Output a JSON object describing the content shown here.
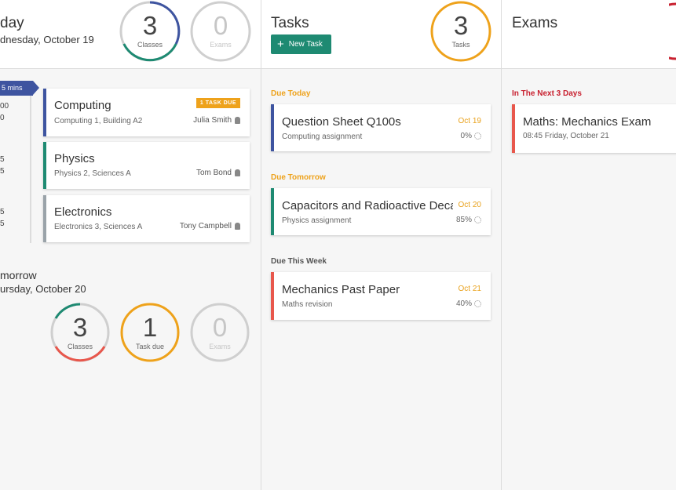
{
  "today": {
    "title": "day",
    "date": "dnesday, October 19",
    "rings": [
      {
        "value": "3",
        "label": "Classes"
      },
      {
        "value": "0",
        "label": "Exams"
      }
    ],
    "countdown": "5 mins",
    "times": [
      "00",
      "0",
      "5",
      "5",
      "5",
      "5"
    ],
    "classes": [
      {
        "name": "Computing",
        "location": "Computing 1, Building A2",
        "teacher": "Julia Smith",
        "badge": "1 TASK DUE",
        "color": "#3e54a0"
      },
      {
        "name": "Physics",
        "location": "Physics 2, Sciences A",
        "teacher": "Tom Bond",
        "color": "#1e8a72"
      },
      {
        "name": "Electronics",
        "location": "Electronics 3, Sciences A",
        "teacher": "Tony Campbell",
        "color": "#9aa3a9"
      }
    ]
  },
  "tomorrow": {
    "title": "morrow",
    "date": "ursday, October 20",
    "rings": [
      {
        "value": "3",
        "label": "Classes"
      },
      {
        "value": "1",
        "label": "Task due"
      },
      {
        "value": "0",
        "label": "Exams"
      }
    ]
  },
  "tasks": {
    "title": "Tasks",
    "new_task_label": "New Task",
    "ring": {
      "value": "3",
      "label": "Tasks"
    },
    "sections": [
      {
        "label": "Due Today",
        "items": [
          {
            "title": "Question Sheet Q100s",
            "subject": "Computing assignment",
            "date": "Oct 19",
            "progress": "0%"
          }
        ]
      },
      {
        "label": "Due Tomorrow",
        "items": [
          {
            "title": "Capacitors and Radioactive Decay",
            "subject": "Physics assignment",
            "date": "Oct 20",
            "progress": "85%"
          }
        ]
      },
      {
        "label": "Due This Week",
        "items": [
          {
            "title": "Mechanics Past Paper",
            "subject": "Maths revision",
            "date": "Oct 21",
            "progress": "40%"
          }
        ]
      }
    ]
  },
  "exams": {
    "title": "Exams",
    "section_label": "In The Next 3 Days",
    "items": [
      {
        "title": "Maths: Mechanics Exam",
        "when": "08:45 Friday, October 21"
      }
    ]
  },
  "colors": {
    "computing": "#3e54a0",
    "physics": "#1e8a72",
    "electronics": "#9aa3a9",
    "maths": "#e8574c",
    "tasks": "#eea21b",
    "exams": "#c8202f",
    "inactive": "#cfcfcf"
  },
  "icons": [
    "plus-icon",
    "teacher-icon",
    "progress-spinner-icon",
    "arrow-tag-icon"
  ]
}
